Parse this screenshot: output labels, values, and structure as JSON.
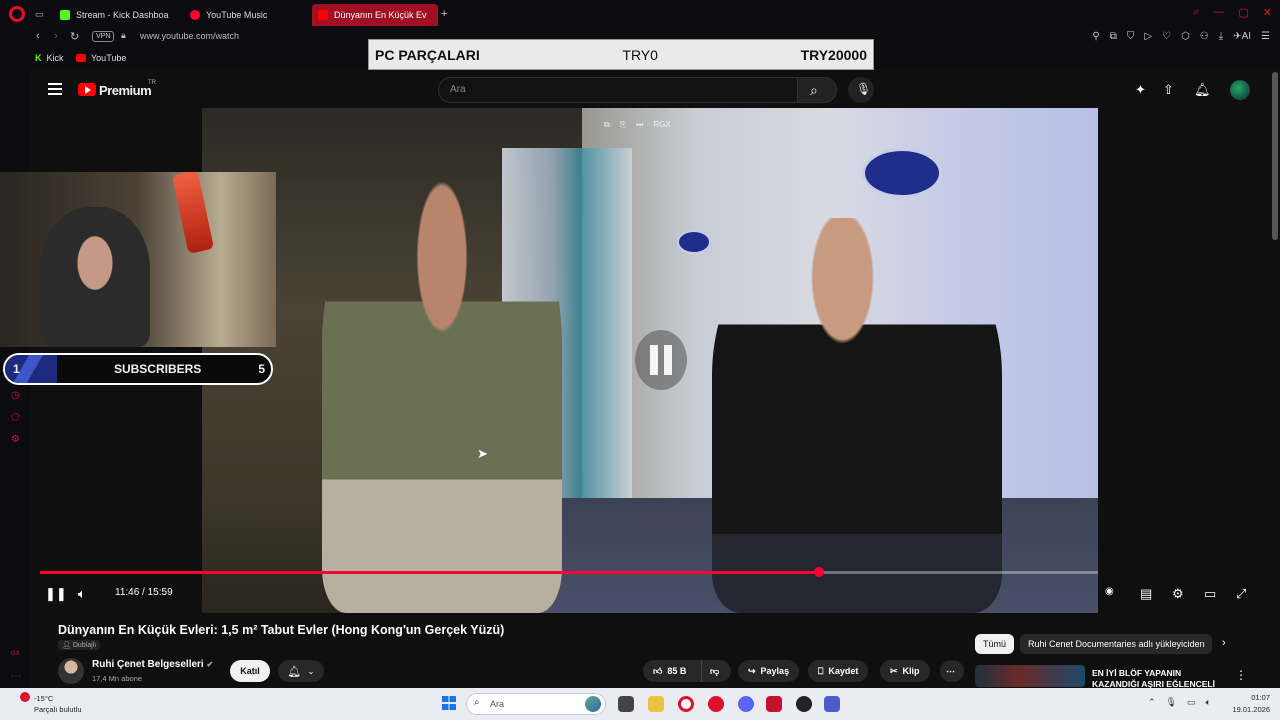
{
  "browser": {
    "tabs": [
      {
        "label": "Stream - Kick Dashboa",
        "fav_color": "#53fc18"
      },
      {
        "label": "YouTube Music",
        "fav_color": "#ff0033"
      },
      {
        "label": "Dünyanın En Küçük Ev",
        "fav_color": "#ff0000"
      }
    ],
    "new_tab": "+",
    "vpn_label": "VPN",
    "url": "www.youtube.com/watch",
    "ai_label": "AI",
    "bookmarks": [
      "Kick",
      "YouTube"
    ]
  },
  "overlay": {
    "title": "PC PARÇALARI",
    "current": "TRY0",
    "goal": "TRY20000"
  },
  "youtube": {
    "brand": "Premium",
    "country": "TR",
    "search_placeholder": "Ara"
  },
  "player": {
    "time": "11:46 / 15:59",
    "progress_fraction": 0.736,
    "mini_badge": "RGX"
  },
  "subscribers": {
    "left": "1",
    "label": "SUBSCRIBERS",
    "right": "5"
  },
  "video": {
    "title": "Dünyanın En Küçük Evleri: 1,5 m² Tabut Evler (Hong Kong'un Gerçek Yüzü)",
    "dubbed": "Dublajlı",
    "channel": "Ruhi Çenet Belgeselleri",
    "channel_subs": "17,4 Mn abone",
    "join": "Katıl",
    "likes": "85 B",
    "share": "Paylaş",
    "save": "Kaydet",
    "clip": "Klip"
  },
  "sidebar_panel": {
    "chip_all": "Tümü",
    "chip_channel": "Ruhi Cenet Documentaries adlı yükleyiciden",
    "rec_title": "EN İYİ BLÖF YAPANIN KAZANDIĞI AŞIRI EĞLENCELİ"
  },
  "taskbar": {
    "temp": "-15°C",
    "weather": "Parçalı bulutlu",
    "search": "Ara",
    "time": "01:07",
    "date": "19.01.2026"
  },
  "left_strip": {
    "bottom_label": "GX"
  }
}
